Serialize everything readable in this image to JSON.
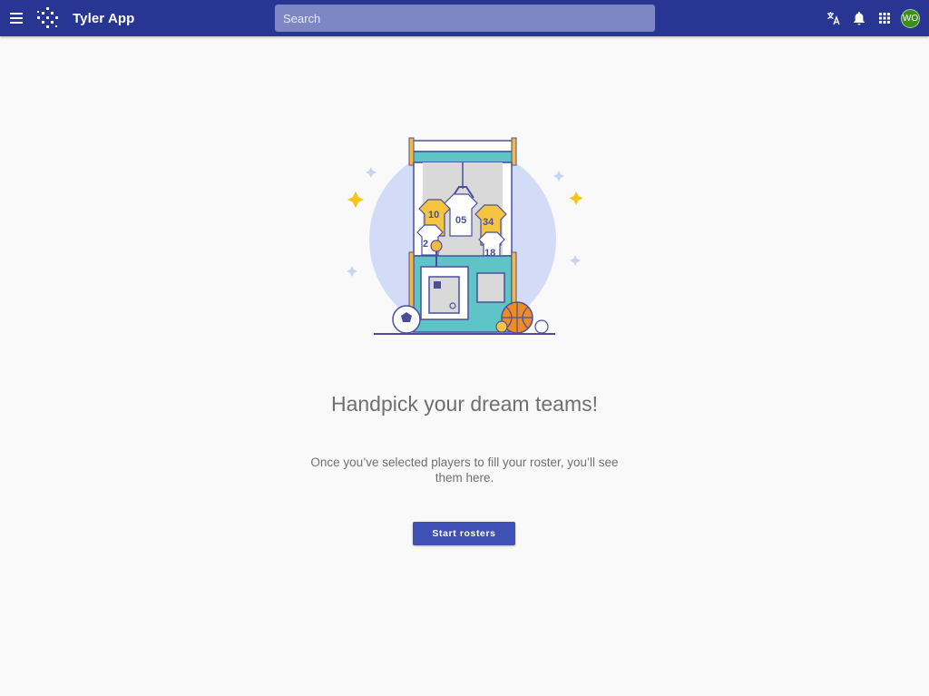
{
  "header": {
    "app_title": "Tyler App",
    "search_placeholder": "Search",
    "avatar_initials": "WO",
    "icons": [
      "menu-icon",
      "logo-icon",
      "translate-icon",
      "bell-icon",
      "apps-grid-icon"
    ]
  },
  "empty_state": {
    "headline": "Handpick your dream teams!",
    "message": "Once you’ve selected players to fill your roster, you’ll see them here.",
    "button_label": "Start rosters",
    "jersey_numbers": [
      "10",
      "05",
      "34",
      "2",
      "18"
    ]
  },
  "colors": {
    "appbar": "#283593",
    "primary_button": "#3f51b5",
    "search_bg": "#7f86c4",
    "avatar": "#3e8e1f",
    "background": "#f9f9f9"
  }
}
